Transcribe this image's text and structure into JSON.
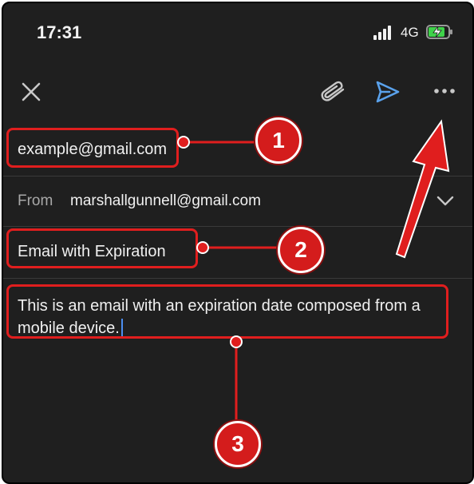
{
  "status_bar": {
    "time": "17:31",
    "network": "4G",
    "icons": [
      "signal-icon",
      "battery-charging-icon"
    ]
  },
  "toolbar": {
    "icons": [
      "close-icon",
      "attach-icon",
      "send-icon",
      "more-icon"
    ],
    "send_color": "#5aa2ec"
  },
  "compose": {
    "to_value": "example@gmail.com",
    "from_label": "From",
    "from_value": "marshallgunnell@gmail.com",
    "subject_value": "Email with Expiration",
    "body_value": "This is an email with an expiration date composed from a mobile device."
  },
  "annotations": {
    "badge_1": "1",
    "badge_2": "2",
    "badge_3": "3",
    "color": "#e01e1e"
  }
}
